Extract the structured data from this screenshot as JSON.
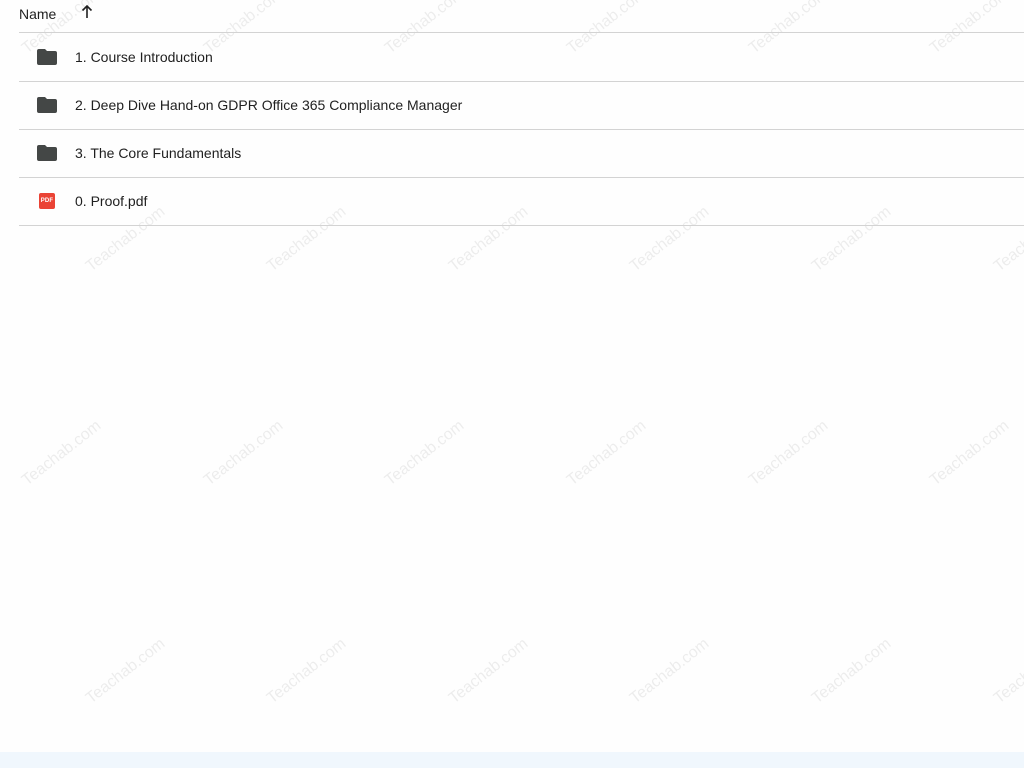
{
  "header": {
    "name_label": "Name",
    "sort_icon": "arrow-up-icon"
  },
  "files": [
    {
      "name": "1. Course Introduction",
      "type": "folder",
      "icon": "folder-icon"
    },
    {
      "name": "2. Deep Dive Hand-on GDPR Office 365 Compliance Manager",
      "type": "folder",
      "icon": "folder-icon"
    },
    {
      "name": "3. The Core Fundamentals",
      "type": "folder",
      "icon": "folder-icon"
    },
    {
      "name": "0. Proof.pdf",
      "type": "pdf",
      "icon": "pdf-icon",
      "icon_label": "PDF"
    }
  ],
  "watermark": {
    "text": "Teachab.com"
  },
  "colors": {
    "folder": "#444746",
    "pdf": "#ea4335",
    "divider": "#d3d3d3"
  }
}
